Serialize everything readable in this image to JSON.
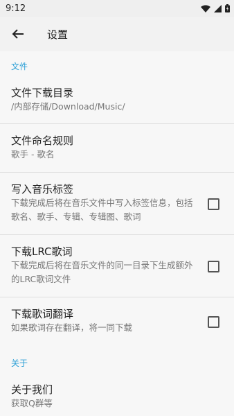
{
  "status_bar": {
    "time": "9:12"
  },
  "app_bar": {
    "title": "设置"
  },
  "sections": [
    {
      "header": "文件"
    },
    {
      "header": "关于"
    }
  ],
  "prefs": {
    "download_dir": {
      "title": "文件下载目录",
      "summary": "/内部存储/Download/Music/"
    },
    "naming_rule": {
      "title": "文件命名规则",
      "summary": "歌手 - 歌名"
    },
    "write_tags": {
      "title": "写入音乐标签",
      "summary": "下载完成后将在音乐文件中写入标签信息，包括歌名、歌手、专辑、专辑图、歌词",
      "checked": false
    },
    "download_lrc": {
      "title": "下载LRC歌词",
      "summary": "下载完成后将在音乐文件的同一目录下生成额外的LRC歌词文件",
      "checked": false
    },
    "download_translation": {
      "title": "下载歌词翻译",
      "summary": "如果歌词存在翻译，将一同下载",
      "checked": false
    },
    "about_us": {
      "title": "关于我们",
      "summary": "获取Q群等"
    }
  },
  "colors": {
    "accent": "#2a9fd6",
    "background": "#f7f7f7"
  }
}
